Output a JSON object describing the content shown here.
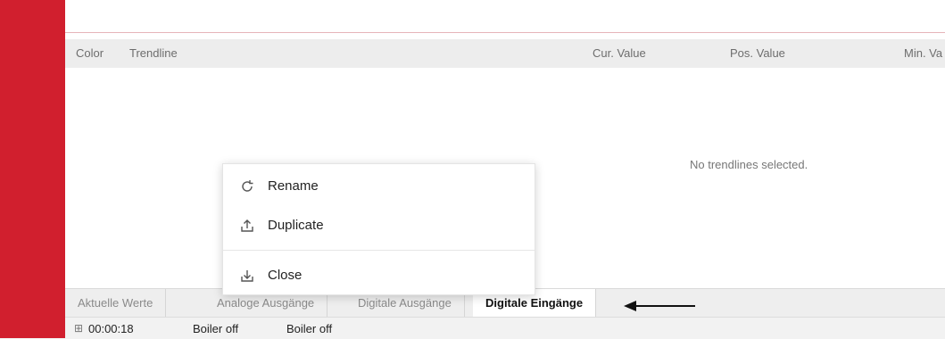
{
  "table": {
    "columns": [
      "Color",
      "Trendline",
      "Cur. Value",
      "Pos. Value",
      "Min. Va"
    ],
    "empty_message": "No trendlines selected."
  },
  "context_menu": {
    "items": [
      {
        "label": "Rename",
        "icon": "refresh-icon"
      },
      {
        "label": "Duplicate",
        "icon": "upload-icon"
      },
      {
        "label": "Close",
        "icon": "download-icon"
      }
    ]
  },
  "tabs": [
    {
      "label": "Aktuelle Werte",
      "active": false
    },
    {
      "label": "Analoge Ausgänge",
      "active": false
    },
    {
      "label": "Digitale Ausgänge",
      "active": false
    },
    {
      "label": "Digitale Eingänge",
      "active": true
    }
  ],
  "status_bar": {
    "time": "00:00:18",
    "status1": "Boiler off",
    "status2": "Boiler off"
  },
  "colors": {
    "sidebar_red": "#d11f2e",
    "header_bg": "#ededed"
  }
}
